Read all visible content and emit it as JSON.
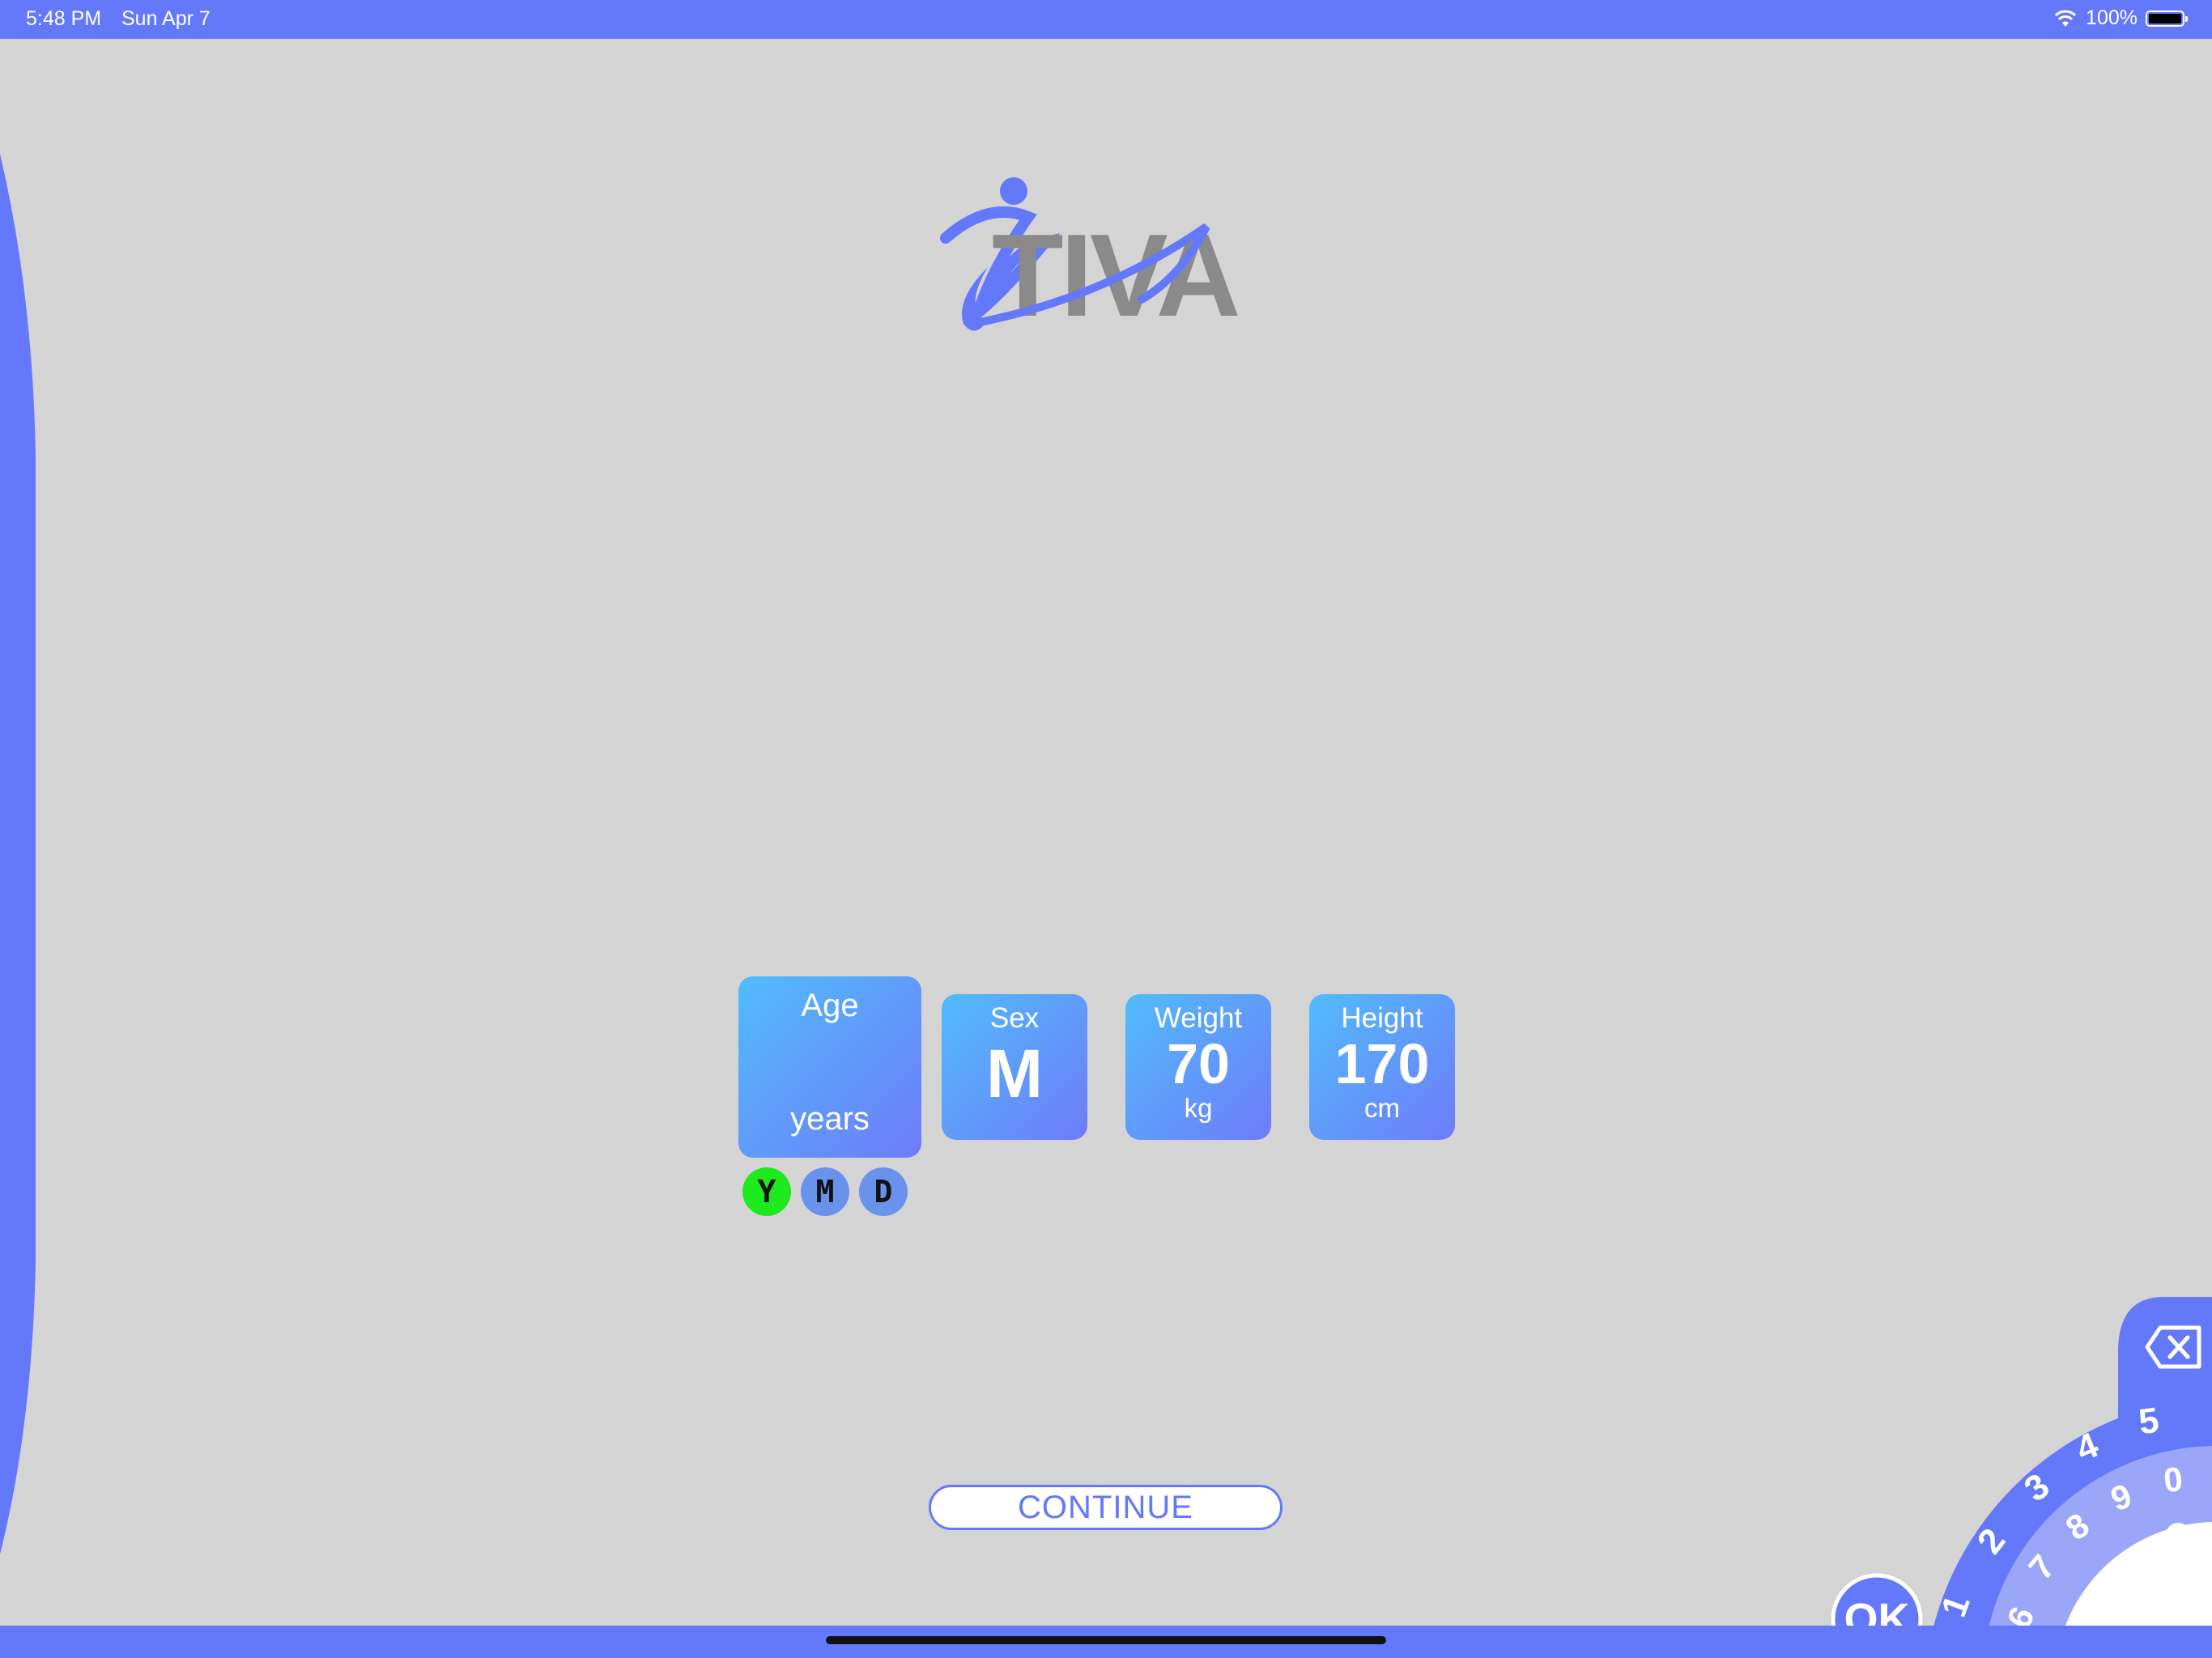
{
  "status_bar": {
    "time": "5:48 PM",
    "date": "Sun Apr 7",
    "battery": "100%"
  },
  "logo": {
    "text": "TIVA"
  },
  "patient": {
    "age": {
      "label": "Age",
      "value": "",
      "unit": "years"
    },
    "sex": {
      "label": "Sex",
      "value": "M"
    },
    "weight": {
      "label": "Weight",
      "value": "70",
      "unit": "kg"
    },
    "height": {
      "label": "Height",
      "value": "170",
      "unit": "cm"
    }
  },
  "age_units": {
    "y": "Y",
    "m": "M",
    "d": "D",
    "selected": "Y"
  },
  "continue_label": "CONTINUE",
  "dial": {
    "ok_label": "OK",
    "outer_digits": [
      "1",
      "2",
      "3",
      "4",
      "5"
    ],
    "inner_digits": [
      "6",
      "7",
      "8",
      "9",
      "0"
    ]
  },
  "colors": {
    "accent": "#6478fa",
    "selected": "#1ee81e",
    "tile_start": "#52bcfc",
    "tile_end": "#6e7bf8"
  }
}
